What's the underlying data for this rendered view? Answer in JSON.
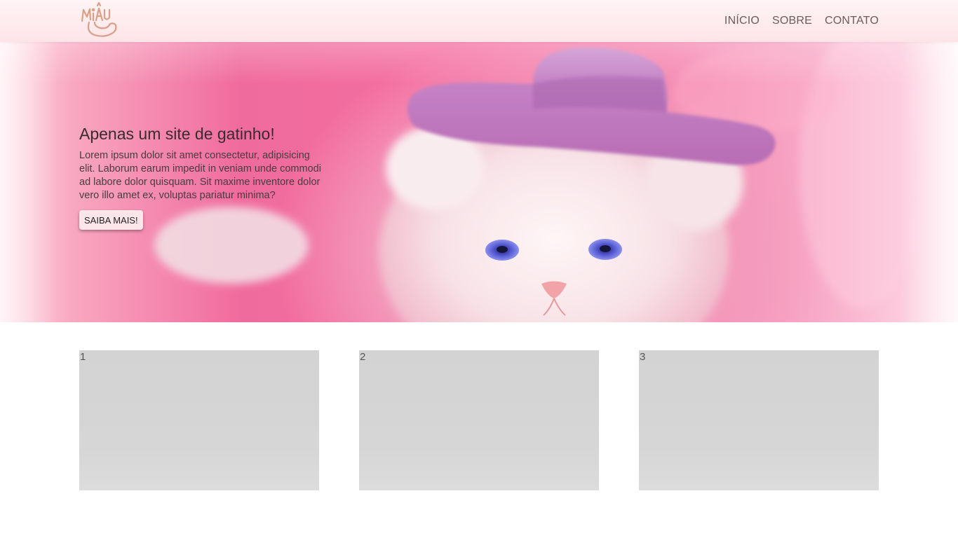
{
  "brand": {
    "logo_text": "MIAU",
    "logo_color": "#d9a089"
  },
  "nav": {
    "items": [
      {
        "label": "INÍCIO"
      },
      {
        "label": "SOBRE"
      },
      {
        "label": "CONTATO"
      }
    ]
  },
  "hero": {
    "title": "Apenas um site de gatinho!",
    "description": "Lorem ipsum dolor sit amet consectetur, adipisicing elit. Laborum earum impedit in veniam unde commodi ad labore dolor quisquam. Sit maxime inventore dolor vero illo amet ex, voluptas pariatur minima?",
    "button_label": "SAIBA MAIS!",
    "image_subject": "white-kitten-pink-hat"
  },
  "cards": [
    {
      "label": "1"
    },
    {
      "label": "2"
    },
    {
      "label": "3"
    }
  ],
  "colors": {
    "header_bg": "#fde4e7",
    "hero_pink": "#f06b9d",
    "hat_purple": "#c77dc0",
    "button_bg": "#fde6ea",
    "card_bg": "#d3d3d3"
  }
}
